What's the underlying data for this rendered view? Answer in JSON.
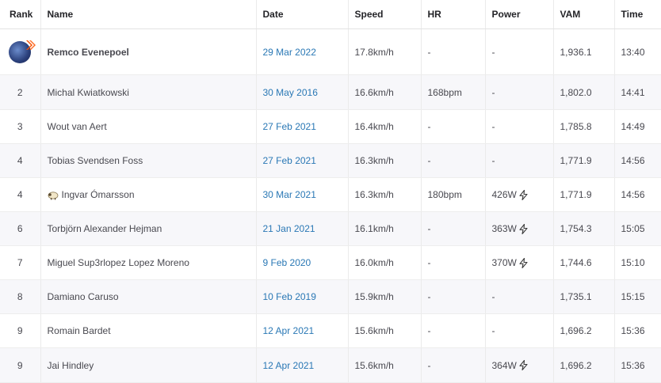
{
  "headers": {
    "rank": "Rank",
    "name": "Name",
    "date": "Date",
    "speed": "Speed",
    "hr": "HR",
    "power": "Power",
    "vam": "VAM",
    "time": "Time"
  },
  "rows": [
    {
      "rank": "",
      "name": "Remco Evenepoel",
      "date": "29 Mar 2022",
      "speed": "17.8km/h",
      "hr": "-",
      "power": "-",
      "vam": "1,936.1",
      "time": "13:40"
    },
    {
      "rank": "2",
      "name": "Michal Kwiatkowski",
      "date": "30 May 2016",
      "speed": "16.6km/h",
      "hr": "168bpm",
      "power": "-",
      "vam": "1,802.0",
      "time": "14:41"
    },
    {
      "rank": "3",
      "name": "Wout van Aert",
      "date": "27 Feb 2021",
      "speed": "16.4km/h",
      "hr": "-",
      "power": "-",
      "vam": "1,785.8",
      "time": "14:49"
    },
    {
      "rank": "4",
      "name": "Tobias Svendsen Foss",
      "date": "27 Feb 2021",
      "speed": "16.3km/h",
      "hr": "-",
      "power": "-",
      "vam": "1,771.9",
      "time": "14:56"
    },
    {
      "rank": "4",
      "name": "Ingvar Ómarsson",
      "date": "30 Mar 2021",
      "speed": "16.3km/h",
      "hr": "180bpm",
      "power": "426W",
      "vam": "1,771.9",
      "time": "14:56"
    },
    {
      "rank": "6",
      "name": "Torbjörn Alexander Hejman",
      "date": "21 Jan 2021",
      "speed": "16.1km/h",
      "hr": "-",
      "power": "363W",
      "vam": "1,754.3",
      "time": "15:05"
    },
    {
      "rank": "7",
      "name": "Miguel Sup3rlopez Lopez Moreno",
      "date": "9 Feb 2020",
      "speed": "16.0km/h",
      "hr": "-",
      "power": "370W",
      "vam": "1,744.6",
      "time": "15:10"
    },
    {
      "rank": "8",
      "name": "Damiano Caruso",
      "date": "10 Feb 2019",
      "speed": "15.9km/h",
      "hr": "-",
      "power": "-",
      "vam": "1,735.1",
      "time": "15:15"
    },
    {
      "rank": "9",
      "name": "Romain Bardet",
      "date": "12 Apr 2021",
      "speed": "15.6km/h",
      "hr": "-",
      "power": "-",
      "vam": "1,696.2",
      "time": "15:36"
    },
    {
      "rank": "9",
      "name": "Jai Hindley",
      "date": "12 Apr 2021",
      "speed": "15.6km/h",
      "hr": "-",
      "power": "364W",
      "vam": "1,696.2",
      "time": "15:36"
    }
  ],
  "icons": {
    "avatar": "athlete-avatar",
    "flag": "sheep-flag-icon",
    "bolt": "lightning-bolt-icon"
  },
  "colors": {
    "date_link": "#2a78b5",
    "badge": "#fc5200",
    "row_alt": "#f7f7fa"
  }
}
